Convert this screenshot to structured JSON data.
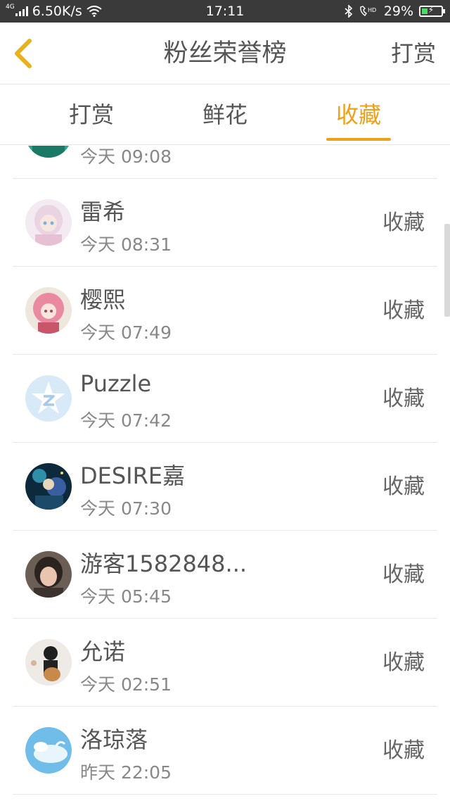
{
  "status_bar": {
    "network": "4G",
    "speed": "6.50K/s",
    "time": "17:11",
    "battery": "29%",
    "battery_level": 0.29,
    "icons": [
      "wifi-icon",
      "bluetooth-icon",
      "hd-call-icon",
      "battery-charging-icon"
    ]
  },
  "header": {
    "title": "粉丝荣誉榜",
    "action": "打赏",
    "back_icon": "chevron-left-icon"
  },
  "tabs": [
    {
      "label": "打赏",
      "active": false
    },
    {
      "label": "鲜花",
      "active": false
    },
    {
      "label": "收藏",
      "active": true
    }
  ],
  "accent_color": "#f0a018",
  "records": [
    {
      "name": "",
      "time": "今天 09:08",
      "type": ""
    },
    {
      "name": "雷希",
      "time": "今天 08:31",
      "type": "收藏"
    },
    {
      "name": "樱熙",
      "time": "今天 07:49",
      "type": "收藏"
    },
    {
      "name": "Puzzle",
      "time": "今天 07:42",
      "type": "收藏"
    },
    {
      "name": "DESIRE嘉",
      "time": "今天 07:30",
      "type": "收藏"
    },
    {
      "name": "游客1582848...",
      "time": "今天 05:45",
      "type": "收藏"
    },
    {
      "name": "允诺",
      "time": "今天 02:51",
      "type": "收藏"
    },
    {
      "name": "洛琼落",
      "time": "昨天 22:05",
      "type": "收藏"
    }
  ]
}
